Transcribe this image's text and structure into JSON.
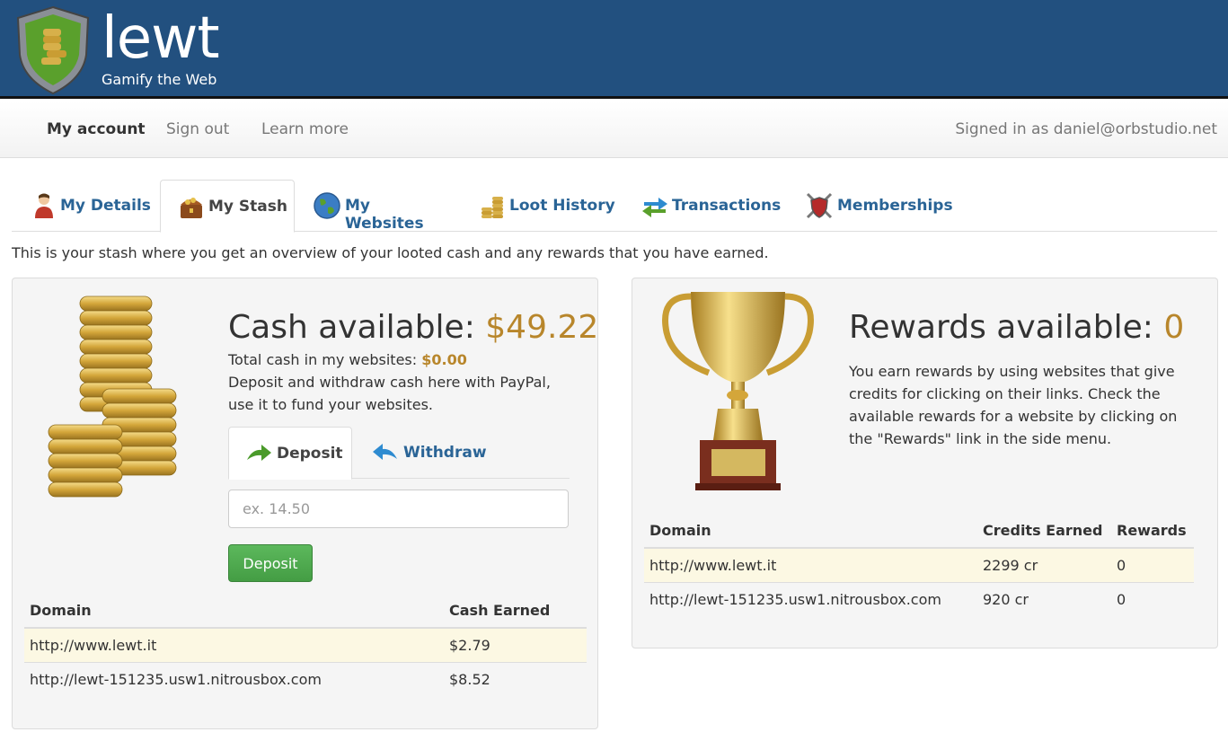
{
  "brand": {
    "name": "lewt",
    "tagline": "Gamify the Web"
  },
  "nav": {
    "items": [
      {
        "label": "My account"
      },
      {
        "label": "Sign out"
      },
      {
        "label": "Learn more"
      }
    ],
    "signed_in": "Signed in as daniel@orbstudio.net"
  },
  "tabs": [
    {
      "label": "My Details",
      "icon": "person-icon"
    },
    {
      "label": "My Stash",
      "icon": "treasure-chest-icon"
    },
    {
      "label": "My Websites",
      "icon": "globe-icon"
    },
    {
      "label": "Loot History",
      "icon": "coins-icon"
    },
    {
      "label": "Transactions",
      "icon": "exchange-arrows-icon"
    },
    {
      "label": "Memberships",
      "icon": "crossed-swords-shield-icon"
    }
  ],
  "intro": "This is your stash where you get an overview of your looted cash and any rewards that you have earned.",
  "cash": {
    "title": "Cash available: ",
    "amount": "$49.22",
    "total_label": "Total cash in my websites: ",
    "total_value": "$0.00",
    "description": "Deposit and withdraw cash here with PayPal, use it to fund your websites.",
    "deposit_tab": "Deposit",
    "withdraw_tab": "Withdraw",
    "input_placeholder": "ex. 14.50",
    "deposit_button": "Deposit",
    "table": {
      "headers": [
        "Domain",
        "Cash Earned"
      ],
      "rows": [
        [
          "http://www.lewt.it",
          "$2.79"
        ],
        [
          "http://lewt-151235.usw1.nitrousbox.com",
          "$8.52"
        ]
      ]
    }
  },
  "rewards": {
    "title": "Rewards available: ",
    "amount": "0",
    "description": "You earn rewards by using websites that give credits for clicking on their links. Check the available rewards for a website by clicking on the \"Rewards\" link in the side menu.",
    "table": {
      "headers": [
        "Domain",
        "Credits Earned",
        "Rewards"
      ],
      "rows": [
        [
          "http://www.lewt.it",
          "2299 cr",
          "0"
        ],
        [
          "http://lewt-151235.usw1.nitrousbox.com",
          "920 cr",
          "0"
        ]
      ]
    }
  },
  "colors": {
    "header": "#22507f",
    "gold": "#b8862b",
    "link": "#2a6496",
    "button": "#449d44"
  }
}
